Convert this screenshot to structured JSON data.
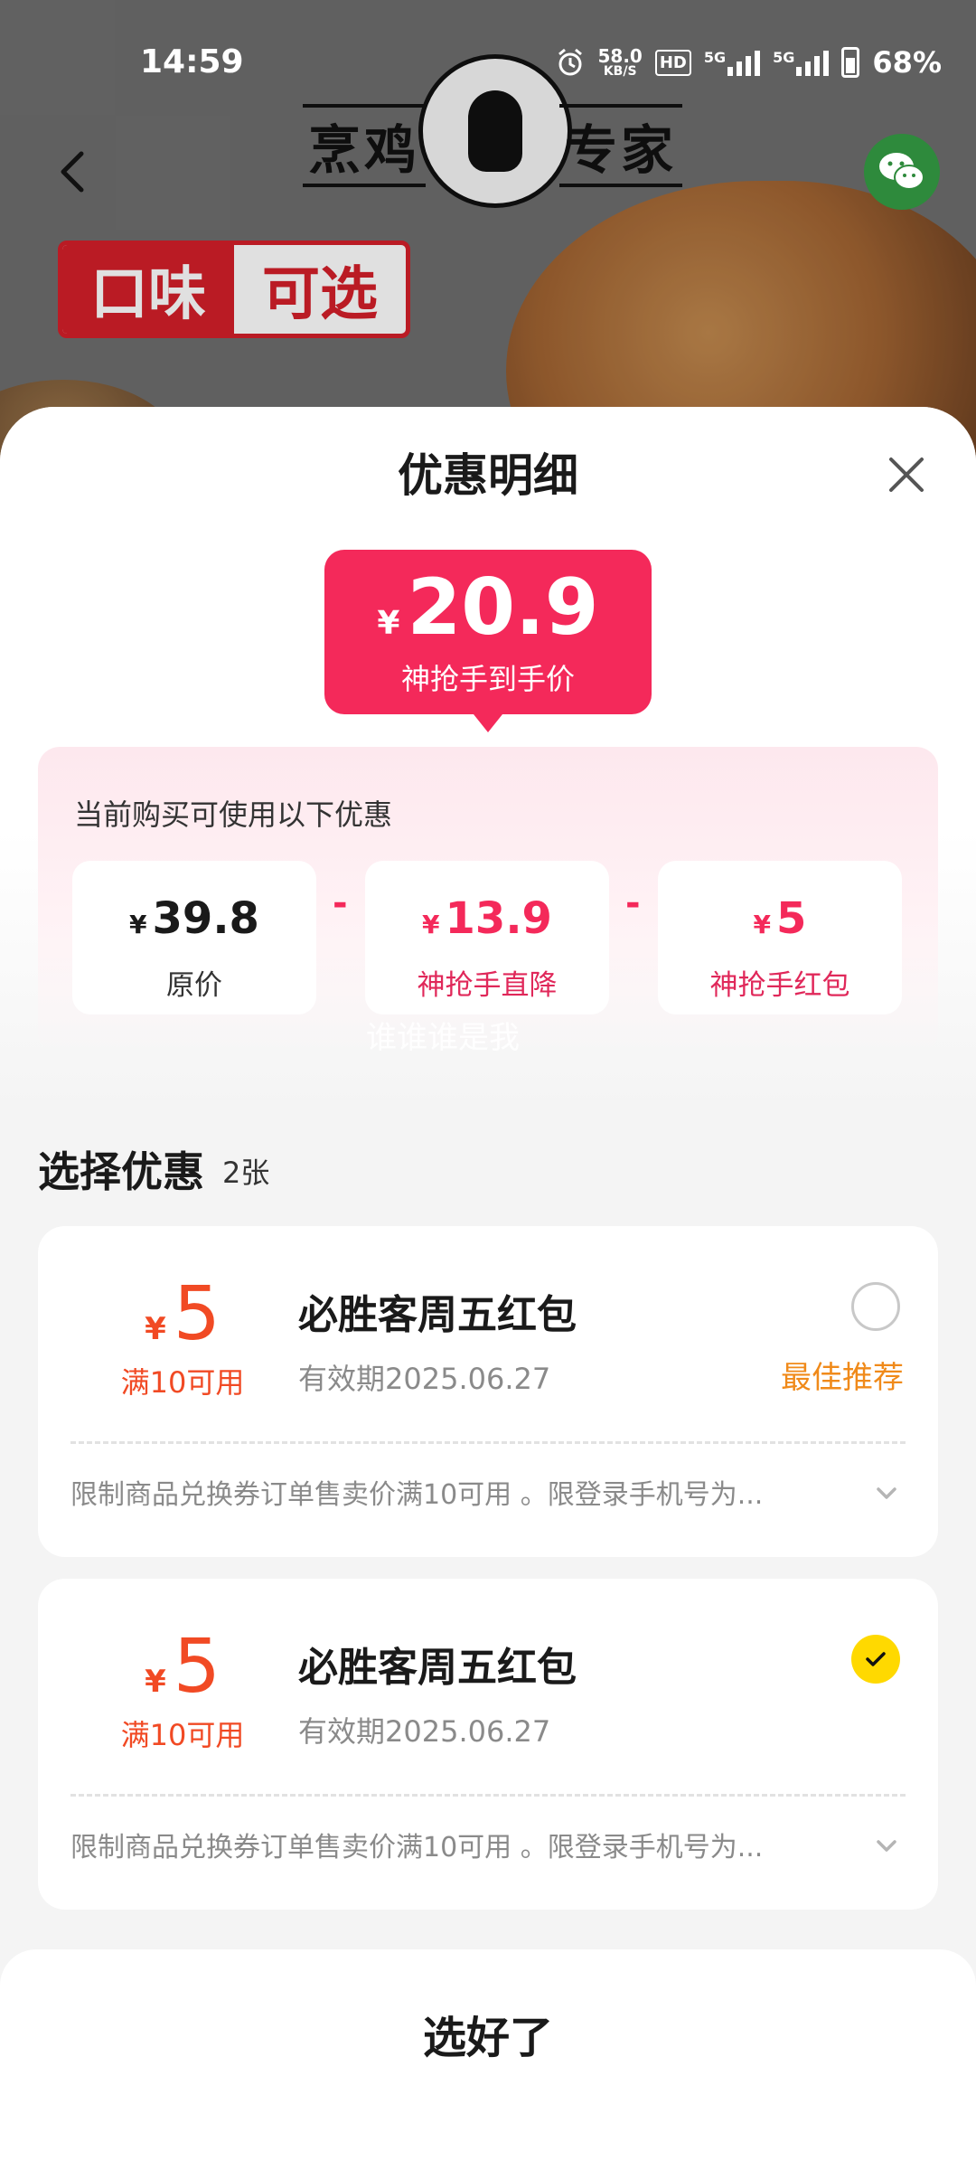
{
  "status_bar": {
    "time": "14:59",
    "net_speed_top": "58.0",
    "net_speed_bottom": "KB/S",
    "hd": "HD",
    "net1": "5G",
    "net2": "5G",
    "battery": "68%"
  },
  "hero": {
    "brand_left": "烹鸡",
    "brand_right": "专家",
    "promo_part1": "口味",
    "promo_part2": "可选"
  },
  "sheet": {
    "title": "优惠明细",
    "final_price": {
      "currency": "¥",
      "amount": "20.9",
      "label": "神抢手到手价"
    },
    "breakdown": {
      "title": "当前购买可使用以下优惠",
      "items": [
        {
          "currency": "¥",
          "amount": "39.8",
          "label": "原价"
        },
        {
          "currency": "¥",
          "amount": "13.9",
          "label": "神抢手直降"
        },
        {
          "currency": "¥",
          "amount": "5",
          "label": "神抢手红包"
        }
      ],
      "operator": "-"
    },
    "watermark": "谁谁谁是我",
    "choose": {
      "title": "选择优惠",
      "count": "2张"
    },
    "coupons": [
      {
        "currency": "¥",
        "amount": "5",
        "condition": "满10可用",
        "name": "必胜客周五红包",
        "validity": "有效期2025.06.27",
        "recommend": "最佳推荐",
        "selected": false,
        "note": "限制商品兑换券订单售卖价满10可用 。限登录手机号为..."
      },
      {
        "currency": "¥",
        "amount": "5",
        "condition": "满10可用",
        "name": "必胜客周五红包",
        "validity": "有效期2025.06.27",
        "recommend": "",
        "selected": true,
        "note": "限制商品兑换券订单售卖价满10可用 。限登录手机号为..."
      }
    ],
    "confirm_label": "选好了"
  },
  "colors": {
    "accent": "#f4295a",
    "coupon_red": "#f14a24",
    "recommend_orange": "#f08a1a",
    "check_yellow": "#ffd900"
  }
}
